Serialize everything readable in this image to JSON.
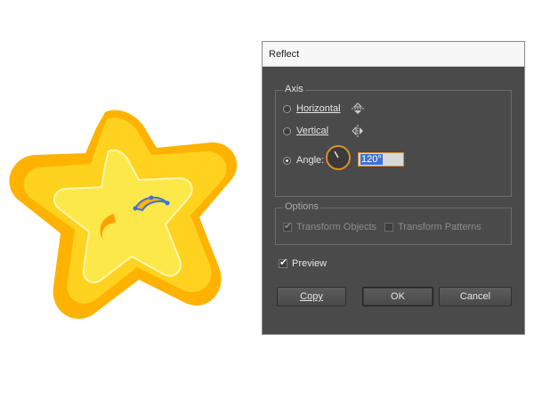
{
  "dialog": {
    "title": "Reflect",
    "axis": {
      "legend": "Axis",
      "horizontal_label": "Horizontal",
      "vertical_label": "Vertical",
      "angle_label": "Angle:",
      "angle_value": "120°",
      "selected": "angle"
    },
    "options": {
      "legend": "Options",
      "transform_objects_label": "Transform Objects",
      "transform_patterns_label": "Transform Patterns"
    },
    "preview_label": "Preview",
    "buttons": {
      "copy": "Copy",
      "ok": "OK",
      "cancel": "Cancel"
    }
  },
  "icons": {
    "horizontal": "reflect-horizontal-icon",
    "vertical": "reflect-vertical-icon"
  },
  "colors": {
    "dialog_bg": "#4a4a4a",
    "focus_accent": "#d9902a",
    "star_yellow": "#ffd21f",
    "star_orange": "#ffb300",
    "selection_blue": "#3d6fe0"
  }
}
